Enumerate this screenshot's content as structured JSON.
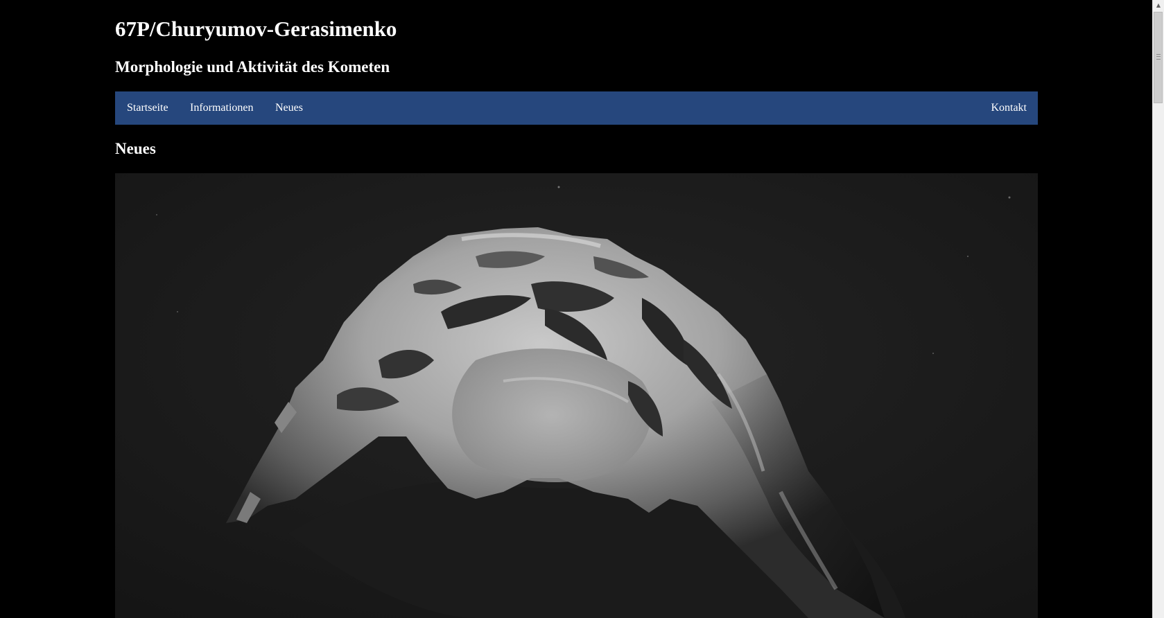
{
  "header": {
    "title": "67P/Churyumov-Gerasimenko",
    "subtitle": "Morphologie und Aktivität des Kometen"
  },
  "nav": {
    "items": [
      {
        "label": "Startseite"
      },
      {
        "label": "Informationen"
      },
      {
        "label": "Neues"
      }
    ],
    "contact_label": "Kontakt"
  },
  "main": {
    "section_heading": "Neues"
  },
  "colors": {
    "page_background": "#000000",
    "nav_background": "#26477d",
    "text": "#ffffff"
  }
}
